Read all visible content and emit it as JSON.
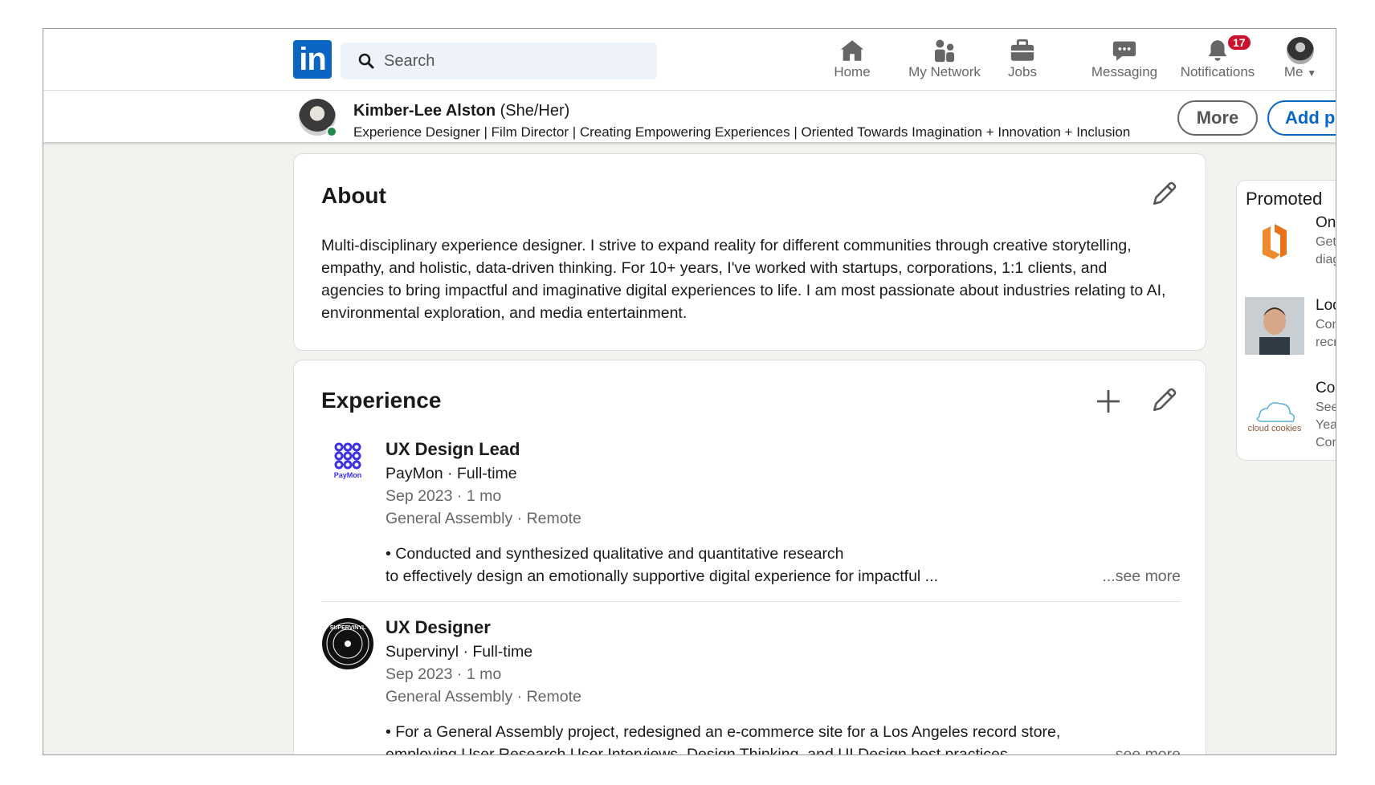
{
  "nav": {
    "logo": "in",
    "search_placeholder": "Search",
    "items": [
      {
        "label": "Home",
        "icon": "home-icon"
      },
      {
        "label": "My Network",
        "icon": "people-icon"
      },
      {
        "label": "Jobs",
        "icon": "briefcase-icon"
      },
      {
        "label": "Messaging",
        "icon": "chat-icon"
      },
      {
        "label": "Notifications",
        "icon": "bell-icon",
        "badge": "17"
      },
      {
        "label": "Me",
        "icon": "avatar"
      }
    ]
  },
  "profile_bar": {
    "name": "Kimber-Lee Alston",
    "pronouns": "(She/Her)",
    "headline": "Experience Designer | Film Director | Creating Empowering Experiences | Oriented Towards Imagination + Innovation + Inclusion",
    "more_label": "More",
    "add_label": "Add profile section"
  },
  "about": {
    "title": "About",
    "text": "Multi-disciplinary experience designer. I strive to expand reality for different communities through creative storytelling, empathy, and holistic, data-driven thinking. For 10+ years, I've worked with startups, corporations, 1:1 clients, and agencies to bring impactful and imaginative digital experiences to life. I am most passionate about industries relating to AI, environmental exploration, and media entertainment."
  },
  "experience": {
    "title": "Experience",
    "jobs": [
      {
        "title": "UX Design Lead",
        "company_line": "PayMon · Full-time",
        "dates": "Sep 2023 · 1 mo",
        "location": "General Assembly · Remote",
        "desc1": "• Conducted and synthesized qualitative and quantitative research",
        "desc2": "to effectively design an emotionally supportive digital experience for impactful ...",
        "see_more": "...see more",
        "logo_text": "PayMon"
      },
      {
        "title": "UX Designer",
        "company_line": "Supervinyl · Full-time",
        "dates": "Sep 2023 · 1 mo",
        "location": "General Assembly · Remote",
        "desc1": "• For a General Assembly project, redesigned an e-commerce site for a Los Angeles record store,",
        "desc2": "employing User Research User Interviews, Design Thinking, and UI Design best practices ...",
        "see_more": "...see more",
        "logo_text": "SUPERVINYL"
      }
    ]
  },
  "promoted": {
    "title": "Promoted",
    "items": [
      {
        "title": "Onl",
        "lines": [
          "Get",
          "diag"
        ]
      },
      {
        "title": "Loo",
        "lines": [
          "Con",
          "recr"
        ]
      },
      {
        "title": "Cor",
        "lines": [
          "See",
          "Year",
          "Con"
        ],
        "logo_text": "cloud cookies"
      }
    ]
  }
}
